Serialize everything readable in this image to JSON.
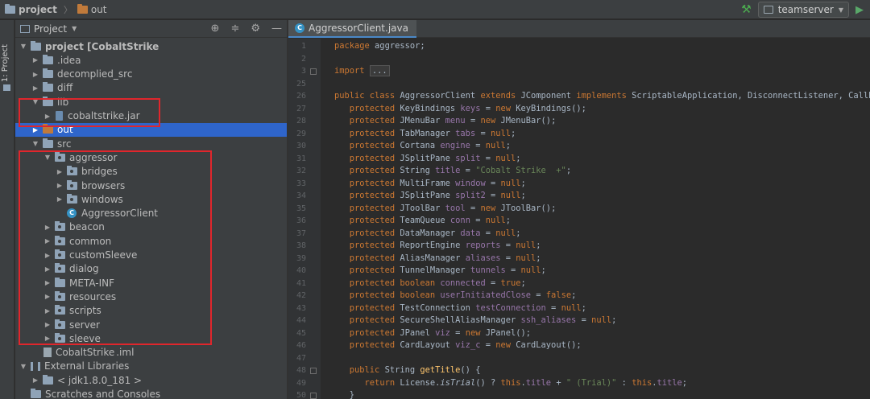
{
  "breadcrumb": {
    "project": "project",
    "sep": "〉",
    "folder": "out"
  },
  "toolbar": {
    "run_config": "teamserver"
  },
  "strip": {
    "label": "1: Project"
  },
  "panel": {
    "title": "Project"
  },
  "tree": [
    {
      "label": "project [CobaltStrike",
      "indent": 0,
      "arrow": "▼",
      "icon": "module",
      "bold": true,
      "blur": "              "
    },
    {
      "label": ".idea",
      "indent": 1,
      "arrow": "▶",
      "icon": "folder"
    },
    {
      "label": "decomplied_src",
      "indent": 1,
      "arrow": "▶",
      "icon": "folder"
    },
    {
      "label": "diff",
      "indent": 1,
      "arrow": "▶",
      "icon": "folder"
    },
    {
      "label": "lib",
      "indent": 1,
      "arrow": "▼",
      "icon": "folder"
    },
    {
      "label": "cobaltstrike.jar",
      "indent": 2,
      "arrow": "▶",
      "icon": "jar"
    },
    {
      "label": "out",
      "indent": 1,
      "arrow": "▶",
      "icon": "folder-orange",
      "selected": true
    },
    {
      "label": "src",
      "indent": 1,
      "arrow": "▼",
      "icon": "folder"
    },
    {
      "label": "aggressor",
      "indent": 2,
      "arrow": "▼",
      "icon": "package"
    },
    {
      "label": "bridges",
      "indent": 3,
      "arrow": "▶",
      "icon": "package"
    },
    {
      "label": "browsers",
      "indent": 3,
      "arrow": "▶",
      "icon": "package"
    },
    {
      "label": "windows",
      "indent": 3,
      "arrow": "▶",
      "icon": "package"
    },
    {
      "label": "AggressorClient",
      "indent": 3,
      "arrow": "",
      "icon": "class"
    },
    {
      "label": "beacon",
      "indent": 2,
      "arrow": "▶",
      "icon": "package"
    },
    {
      "label": "common",
      "indent": 2,
      "arrow": "▶",
      "icon": "package"
    },
    {
      "label": "customSleeve",
      "indent": 2,
      "arrow": "▶",
      "icon": "package"
    },
    {
      "label": "dialog",
      "indent": 2,
      "arrow": "▶",
      "icon": "package"
    },
    {
      "label": "META-INF",
      "indent": 2,
      "arrow": "▶",
      "icon": "folder"
    },
    {
      "label": "resources",
      "indent": 2,
      "arrow": "▶",
      "icon": "package"
    },
    {
      "label": "scripts",
      "indent": 2,
      "arrow": "▶",
      "icon": "package"
    },
    {
      "label": "server",
      "indent": 2,
      "arrow": "▶",
      "icon": "package"
    },
    {
      "label": "sleeve",
      "indent": 2,
      "arrow": "▶",
      "icon": "package"
    },
    {
      "label": "CobaltStrike",
      "indent": 1,
      "arrow": "",
      "icon": "file",
      "blur": "    ",
      "suffix": ".iml"
    },
    {
      "label": "External Libraries",
      "indent": 0,
      "arrow": "▼",
      "icon": "libs"
    },
    {
      "label": "< jdk1.8.0_181 >",
      "indent": 1,
      "arrow": "▶",
      "icon": "folder",
      "blur": "                      "
    },
    {
      "label": "Scratches and Consoles",
      "indent": 0,
      "arrow": "",
      "icon": "scratch"
    }
  ],
  "editor": {
    "tab": "AggressorClient.java",
    "lines": [
      {
        "n": "1",
        "html": "<span class=\"kw\">package</span> aggressor;"
      },
      {
        "n": "2",
        "html": ""
      },
      {
        "n": "3",
        "html": "<span class=\"kw\">import</span> <span class=\"fold-box\">...</span>",
        "fold": true
      },
      {
        "n": "25",
        "html": ""
      },
      {
        "n": "26",
        "html": "<span class=\"kw\">public class</span> AggressorClient <span class=\"kw\">extends</span> JComponent <span class=\"kw\">implements</span> ScriptableApplication, DisconnectListener, Callback"
      },
      {
        "n": "27",
        "html": "   <span class=\"kw\">protected</span> KeyBindings <span class=\"fld\">keys</span> = <span class=\"kw\">new</span> KeyBindings();"
      },
      {
        "n": "28",
        "html": "   <span class=\"kw\">protected</span> JMenuBar <span class=\"fld\">menu</span> = <span class=\"kw\">new</span> JMenuBar();"
      },
      {
        "n": "29",
        "html": "   <span class=\"kw\">protected</span> TabManager <span class=\"fld\">tabs</span> = <span class=\"kw\">null</span>;"
      },
      {
        "n": "30",
        "html": "   <span class=\"kw\">protected</span> Cortana <span class=\"fld\">engine</span> = <span class=\"kw\">null</span>;"
      },
      {
        "n": "31",
        "html": "   <span class=\"kw\">protected</span> JSplitPane <span class=\"fld\">split</span> = <span class=\"kw\">null</span>;"
      },
      {
        "n": "32",
        "html": "   <span class=\"kw\">protected</span> String <span class=\"fld\">title</span> = <span class=\"str\">\"Cobalt Strike  +\"</span>;"
      },
      {
        "n": "33",
        "html": "   <span class=\"kw\">protected</span> MultiFrame <span class=\"fld\">window</span> = <span class=\"kw\">null</span>;"
      },
      {
        "n": "34",
        "html": "   <span class=\"kw\">protected</span> JSplitPane <span class=\"fld\">split2</span> = <span class=\"kw\">null</span>;"
      },
      {
        "n": "35",
        "html": "   <span class=\"kw\">protected</span> JToolBar <span class=\"fld\">tool</span> = <span class=\"kw\">new</span> JToolBar();"
      },
      {
        "n": "36",
        "html": "   <span class=\"kw\">protected</span> TeamQueue <span class=\"fld\">conn</span> = <span class=\"kw\">null</span>;"
      },
      {
        "n": "37",
        "html": "   <span class=\"kw\">protected</span> DataManager <span class=\"fld\">data</span> = <span class=\"kw\">null</span>;"
      },
      {
        "n": "38",
        "html": "   <span class=\"kw\">protected</span> ReportEngine <span class=\"fld\">reports</span> = <span class=\"kw\">null</span>;"
      },
      {
        "n": "39",
        "html": "   <span class=\"kw\">protected</span> AliasManager <span class=\"fld\">aliases</span> = <span class=\"kw\">null</span>;"
      },
      {
        "n": "40",
        "html": "   <span class=\"kw\">protected</span> TunnelManager <span class=\"fld\">tunnels</span> = <span class=\"kw\">null</span>;"
      },
      {
        "n": "41",
        "html": "   <span class=\"kw\">protected boolean</span> <span class=\"fld\">connected</span> = <span class=\"kw\">true</span>;"
      },
      {
        "n": "42",
        "html": "   <span class=\"kw\">protected boolean</span> <span class=\"fld\">userInitiatedClose</span> = <span class=\"kw\">false</span>;"
      },
      {
        "n": "43",
        "html": "   <span class=\"kw\">protected</span> TestConnection <span class=\"fld\">testConnection</span> = <span class=\"kw\">null</span>;"
      },
      {
        "n": "44",
        "html": "   <span class=\"kw\">protected</span> SecureShellAliasManager <span class=\"fld\">ssh_aliases</span> = <span class=\"kw\">null</span>;"
      },
      {
        "n": "45",
        "html": "   <span class=\"kw\">protected</span> JPanel <span class=\"fld\">viz</span> = <span class=\"kw\">new</span> JPanel();"
      },
      {
        "n": "46",
        "html": "   <span class=\"kw\">protected</span> CardLayout <span class=\"fld\">viz_c</span> = <span class=\"kw\">new</span> CardLayout();"
      },
      {
        "n": "47",
        "html": ""
      },
      {
        "n": "48",
        "html": "   <span class=\"kw\">public</span> String <span class=\"fn\">getTitle</span>() {",
        "fold": true
      },
      {
        "n": "49",
        "html": "      <span class=\"kw\">return</span> License.<span class=\"it\">isTrial</span>() ? <span class=\"kw\">this</span>.<span class=\"fld\">title</span> + <span class=\"str\">\" (Trial)\"</span> : <span class=\"kw\">this</span>.<span class=\"fld\">title</span>;"
      },
      {
        "n": "50",
        "html": "   }",
        "fold": true
      }
    ]
  }
}
